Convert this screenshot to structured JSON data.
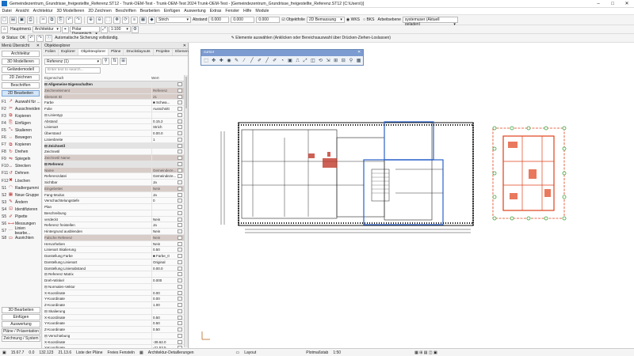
{
  "window": {
    "title": "Gemeindezentrum_Grundrisse_freigestellte_Referenz.ST12 - Trunk-OEM-Test - Trunk-OEM-Test 2024 Trunk-OEM-Test - [Gemeindezentrum_Grundrisse_freigestellte_Referenz.ST12 (C:\\Users\\)]",
    "minimize": "–",
    "maximize": "□",
    "close": "✕"
  },
  "menu": [
    "Datei",
    "Ansicht",
    "Architektur",
    "3D Modellieren",
    "2D Zeichnen",
    "Beschriften",
    "Bearbeiten",
    "Einfügen",
    "Auswertung",
    "Extras",
    "Fenster",
    "Hilfe",
    "Module"
  ],
  "toolbar1": {
    "line_style": "Strich",
    "abstand_label": "Abstand",
    "abstand_value": "0.000",
    "value2": "0.000",
    "value3": "0.000",
    "snap_label": "Objektfolie",
    "dimension": "2D Bemassung",
    "wks_label": "WKS",
    "bks_label": "BKS",
    "plane_label": "Arbeitsebene",
    "system_label": "systemuser (Aktuell geladen)"
  },
  "toolbar2": {
    "home_label": "Hauptmenü",
    "arch_label": "Architektur",
    "polar_label": "Polar Dynamisch",
    "scale_value": "1:100"
  },
  "toolbar3": {
    "status_label": "Status: OK",
    "autosave_text": "Automatische Sicherung vollständig.",
    "hint_text": "Elemente auswählen (Anklicken oder Bereichsauswahl über Drücken-Ziehen-Loslassen)"
  },
  "menu_panel": {
    "title": "Menü Übersicht",
    "nav_top": [
      "Architektur",
      "3D Modellieren",
      "Geländemodell",
      "2D Zeichnen",
      "Beschriften",
      "2D Bearbeiten"
    ],
    "active_index": 5,
    "functions": [
      {
        "key": "F1",
        "icon": "↗",
        "label": "Auswahl für ..."
      },
      {
        "key": "F2",
        "icon": "✂",
        "label": "Ausschneiden"
      },
      {
        "key": "F3",
        "icon": "⧉",
        "label": "Kopieren"
      },
      {
        "key": "F4",
        "icon": "⎘",
        "label": "Einfügen"
      },
      {
        "key": "F5",
        "icon": "⤡",
        "label": "Skalieren"
      },
      {
        "key": "F6",
        "icon": "⇔",
        "label": "Bewegen"
      },
      {
        "key": "F7",
        "icon": "⧉",
        "label": "Kopieren"
      },
      {
        "key": "F8",
        "icon": "↻",
        "label": "Drehen"
      },
      {
        "key": "F9",
        "icon": "⇋",
        "label": "Spiegeln"
      },
      {
        "key": "F10",
        "icon": "↔",
        "label": "Strecken"
      },
      {
        "key": "F11",
        "icon": "↺",
        "label": "Dehnen"
      },
      {
        "key": "F12",
        "icon": "✖",
        "label": "Löschen"
      },
      {
        "key": "S1",
        "icon": "◠",
        "label": "Radiergummi"
      },
      {
        "key": "S2",
        "icon": "▦",
        "label": "Neue Gruppe"
      },
      {
        "key": "S3",
        "icon": "✎",
        "label": "Ändern"
      },
      {
        "key": "S4",
        "icon": "⊡",
        "label": "Identifizieren"
      },
      {
        "key": "S5",
        "icon": "✐",
        "label": "Pipette"
      },
      {
        "key": "S6",
        "icon": "⟷",
        "label": "Messungen"
      },
      {
        "key": "S7",
        "icon": "⋯",
        "label": "Linien bearbe..."
      },
      {
        "key": "S8",
        "icon": "▭",
        "label": "Ausrichten"
      }
    ],
    "nav_bottom": [
      "3D Bearbeiten",
      "Einfügen",
      "Auswertung",
      "Pläne / Präsentation",
      "Zeichnung / System"
    ]
  },
  "obj_panel": {
    "title": "Objektexplorer",
    "tabs": [
      "Folien",
      "Explorer",
      "Objektexplorer",
      "Pläne",
      "Druckslayouts",
      "Projekte",
      "Ebenen"
    ],
    "active_tab": 2,
    "filter_value": "Referenz (1)",
    "search_placeholder": "Enter text to search...",
    "col_property": "Eigenschaft",
    "col_value": "Wert",
    "rows": [
      {
        "n": "⊟  Allgemeine Eigenschaften",
        "v": "",
        "t": "group"
      },
      {
        "n": "Zeichenelement",
        "v": "Referenz",
        "t": "dim"
      },
      {
        "n": "Element ID",
        "v": "21",
        "t": "dim"
      },
      {
        "n": "Farbe",
        "v": "■ Schwa...",
        "t": ""
      },
      {
        "n": "Folie",
        "v": "Ausschnitt",
        "t": ""
      },
      {
        "n": "⊟ Linientyp",
        "v": "",
        "t": ""
      },
      {
        "n": "      Abstand",
        "v": "0.15.2",
        "t": ""
      },
      {
        "n": "      Linienart",
        "v": "Strich",
        "t": ""
      },
      {
        "n": "      Überstand",
        "v": "0.00.0",
        "t": ""
      },
      {
        "n": "      Linienbreite",
        "v": "1",
        "t": ""
      },
      {
        "n": "⊟  Zeichnetil",
        "v": "",
        "t": "group"
      },
      {
        "n": "Zeichnetil",
        "v": "",
        "t": ""
      },
      {
        "n": "Zeichnetil Name",
        "v": "",
        "t": "dim"
      },
      {
        "n": "⊟  Referenz",
        "v": "",
        "t": "group"
      },
      {
        "n": "Name",
        "v": "Gemeindeze...",
        "t": "dim"
      },
      {
        "n": "Referenzdatei",
        "v": "Gemeindeze...",
        "t": ""
      },
      {
        "n": "Sichtbar",
        "v": "Ja",
        "t": ""
      },
      {
        "n": "Eingebettet",
        "v": "Nein",
        "t": "dim"
      },
      {
        "n": "Fang-Modus",
        "v": "Ja",
        "t": ""
      },
      {
        "n": "Verschachtelungstiefe",
        "v": "0",
        "t": ""
      },
      {
        "n": "Plan",
        "v": "",
        "t": ""
      },
      {
        "n": "Beschreibung",
        "v": "",
        "t": ""
      },
      {
        "n": "verdeckt",
        "v": "Nein",
        "t": ""
      },
      {
        "n": "Referenz freistellen",
        "v": "Ja",
        "t": ""
      },
      {
        "n": "Hintergrund ausblenden",
        "v": "Nein",
        "t": ""
      },
      {
        "n": "Falsche Referenz",
        "v": "Nein",
        "t": "dim"
      },
      {
        "n": "Hervorheben",
        "v": "Nein",
        "t": ""
      },
      {
        "n": "Linienart Skalierung",
        "v": "0.50",
        "t": ""
      },
      {
        "n": "Darstellung Farbe",
        "v": "■ Farbe_0",
        "t": ""
      },
      {
        "n": "Darstellung Linienart",
        "v": "Original",
        "t": ""
      },
      {
        "n": "Darstellung Linienabstand",
        "v": "0.00.0",
        "t": ""
      },
      {
        "n": "⊟ Referenz Matrix",
        "v": "",
        "t": ""
      },
      {
        "n": "      Dreh-Winkel",
        "v": "0.000",
        "t": ""
      },
      {
        "n": "   ⊟ Normalen-Vektor",
        "v": "",
        "t": ""
      },
      {
        "n": "         X-Koordinate",
        "v": "0.00",
        "t": ""
      },
      {
        "n": "         Y-Koordinate",
        "v": "0.00",
        "t": ""
      },
      {
        "n": "         Z-Koordinate",
        "v": "1.00",
        "t": ""
      },
      {
        "n": "   ⊟ Skalierung",
        "v": "",
        "t": ""
      },
      {
        "n": "         X-Koordinate",
        "v": "0.50",
        "t": ""
      },
      {
        "n": "         Y-Koordinate",
        "v": "0.50",
        "t": ""
      },
      {
        "n": "         Z-Koordinate",
        "v": "0.50",
        "t": ""
      },
      {
        "n": "   ⊟ Verschiebung",
        "v": "",
        "t": ""
      },
      {
        "n": "         X-Koordinate",
        "v": "-39.62.0",
        "t": ""
      },
      {
        "n": "         Y-Koordinate",
        "v": "-21.53.5",
        "t": ""
      }
    ]
  },
  "float_toolbar": {
    "title": "cursor",
    "icons": [
      "⬚",
      "✥",
      "✚",
      "◉",
      "✎",
      "⁄",
      "╱",
      "✐",
      "╱",
      "✐",
      "◔",
      "▣",
      "⎍",
      "⤢",
      "◫",
      "⟲",
      "⇲",
      "⊞",
      "⊟",
      "⚲",
      "▦"
    ]
  },
  "statusbar": {
    "x_value": "15.67.7",
    "y_value": "0.0",
    "xy_value": "132.123",
    "z_value": "21.13.6",
    "plan_list": "Liste der Pläne",
    "frame_label": "Freies Fensteln",
    "detail_label": "Architektur-Detaillerungen",
    "layout_label": "Layout",
    "scale_label": "Plotmaßstab",
    "scale_value": "1:50"
  },
  "colors": {
    "accent": "#1a6fc4",
    "selection_blue": "#2a62c9",
    "reference_red": "#e0401a",
    "handle_green": "#3aa33a"
  }
}
